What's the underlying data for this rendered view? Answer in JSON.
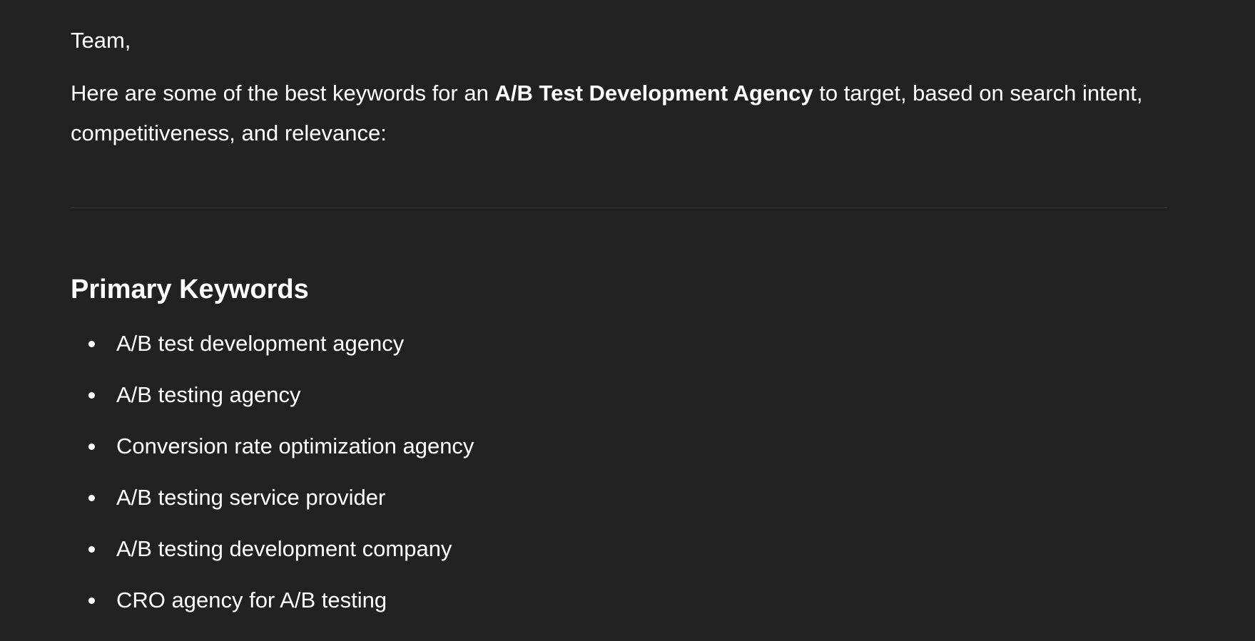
{
  "message": {
    "greeting": "Team,",
    "intro": {
      "before": "Here are some of the best keywords for an ",
      "emphasis": "A/B Test Development Agency",
      "after": " to target, based on search intent, competitiveness, and relevance:"
    }
  },
  "section": {
    "title": "Primary Keywords",
    "items": [
      {
        "text": "A/B test development agency"
      },
      {
        "text": "A/B testing agency"
      },
      {
        "text": "Conversion rate optimization agency"
      },
      {
        "text": "A/B testing service provider"
      },
      {
        "text": "A/B testing development company"
      },
      {
        "text": "CRO agency for A/B testing"
      }
    ]
  },
  "colors": {
    "background": "#212121",
    "text": "#ffffff",
    "divider": "#3a3a3a"
  }
}
